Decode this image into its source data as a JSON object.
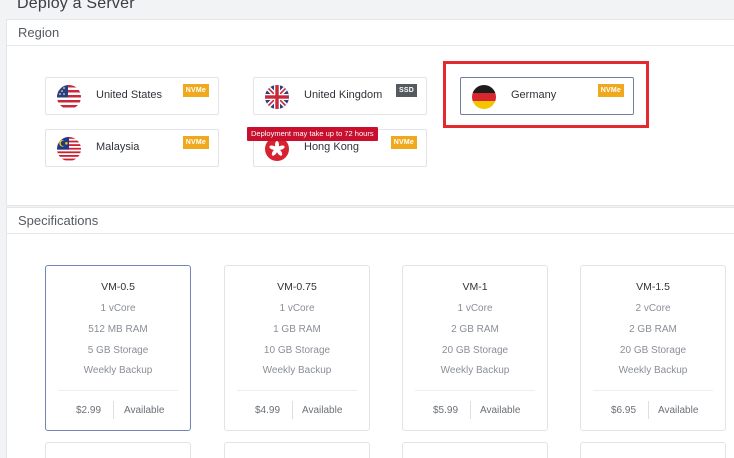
{
  "page": {
    "title": "Deploy a Server"
  },
  "region": {
    "heading": "Region",
    "tooltip": "Deployment may take up to 72 hours",
    "items": [
      {
        "name": "United States",
        "badge": "NVMe",
        "selected": false
      },
      {
        "name": "United Kingdom",
        "badge": "SSD",
        "selected": false
      },
      {
        "name": "Germany",
        "badge": "NVMe",
        "selected": true
      },
      {
        "name": "Malaysia",
        "badge": "NVMe",
        "selected": false
      },
      {
        "name": "Hong Kong",
        "badge": "NVMe",
        "selected": false
      }
    ]
  },
  "specifications": {
    "heading": "Specifications",
    "plans": [
      {
        "name": "VM-0.5",
        "cores": "1 vCore",
        "ram": "512 MB RAM",
        "storage": "5 GB Storage",
        "backup": "Weekly Backup",
        "price": "$2.99",
        "status": "Available",
        "selected": true
      },
      {
        "name": "VM-0.75",
        "cores": "1 vCore",
        "ram": "1 GB RAM",
        "storage": "10 GB Storage",
        "backup": "Weekly Backup",
        "price": "$4.99",
        "status": "Available",
        "selected": false
      },
      {
        "name": "VM-1",
        "cores": "1 vCore",
        "ram": "2 GB RAM",
        "storage": "20 GB Storage",
        "backup": "Weekly Backup",
        "price": "$5.99",
        "status": "Available",
        "selected": false
      },
      {
        "name": "VM-1.5",
        "cores": "2 vCore",
        "ram": "2 GB RAM",
        "storage": "20 GB Storage",
        "backup": "Weekly Backup",
        "price": "$6.95",
        "status": "Available",
        "selected": false
      }
    ]
  },
  "colors": {
    "highlight": "#e32b2f",
    "nvme_badge": "#f0a81c",
    "ssd_badge": "#555a60",
    "tooltip": "#c8102e",
    "selected_border": "#6f86b6"
  },
  "icons": {
    "us": "us-flag-icon",
    "uk": "uk-flag-icon",
    "de": "germany-flag-icon",
    "my": "malaysia-flag-icon",
    "hk": "hong-kong-flag-icon"
  }
}
